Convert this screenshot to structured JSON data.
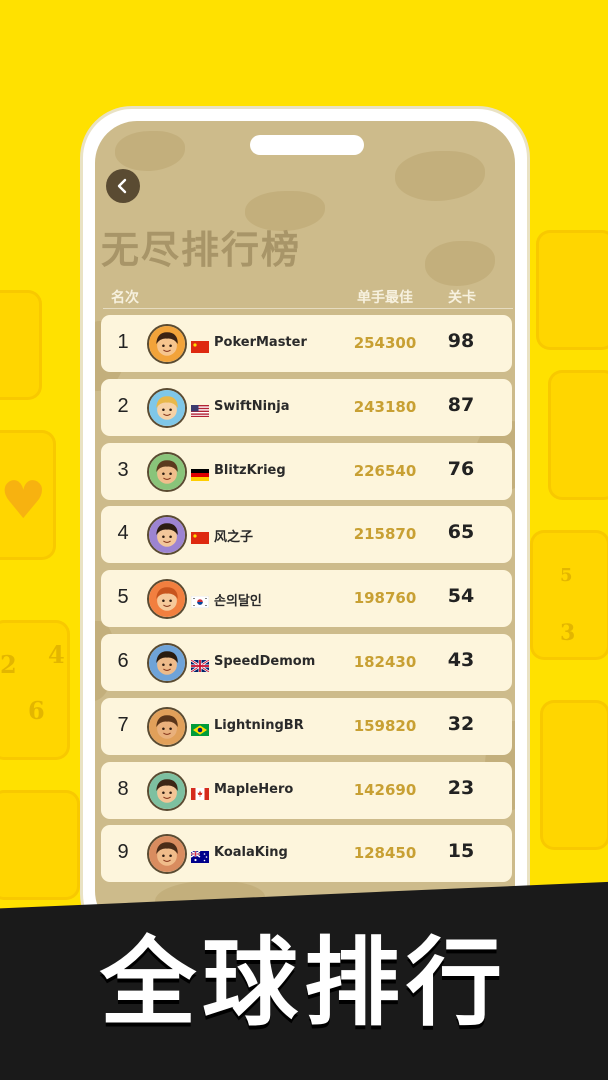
{
  "screen": {
    "title": "无尽排行榜",
    "columns": {
      "rank": "名次",
      "best_score": "单手最佳",
      "level": "关卡"
    },
    "rows": [
      {
        "rank": "1",
        "name": "PokerMaster",
        "country": "cn-flag-icon",
        "score": "254300",
        "level": "98"
      },
      {
        "rank": "2",
        "name": "SwiftNinja",
        "country": "us-flag-icon",
        "score": "243180",
        "level": "87"
      },
      {
        "rank": "3",
        "name": "BlitzKrieg",
        "country": "de-flag-icon",
        "score": "226540",
        "level": "76"
      },
      {
        "rank": "4",
        "name": "风之子",
        "country": "cn-flag-icon",
        "score": "215870",
        "level": "65"
      },
      {
        "rank": "5",
        "name": "손의달인",
        "country": "kr-flag-icon",
        "score": "198760",
        "level": "54"
      },
      {
        "rank": "6",
        "name": "SpeedDemom",
        "country": "gb-flag-icon",
        "score": "182430",
        "level": "43"
      },
      {
        "rank": "7",
        "name": "LightningBR",
        "country": "br-flag-icon",
        "score": "159820",
        "level": "32"
      },
      {
        "rank": "8",
        "name": "MapleHero",
        "country": "ca-flag-icon",
        "score": "142690",
        "level": "23"
      },
      {
        "rank": "9",
        "name": "KoalaKing",
        "country": "au-flag-icon",
        "score": "128450",
        "level": "15"
      }
    ]
  },
  "banner": {
    "text": "全球排行"
  },
  "colors": {
    "background": "#FFE100",
    "screen_bg": "#CDBB8B",
    "row_bg": "#FDF5DC",
    "score": "#C8A033",
    "banner": "#1A1A1A"
  }
}
